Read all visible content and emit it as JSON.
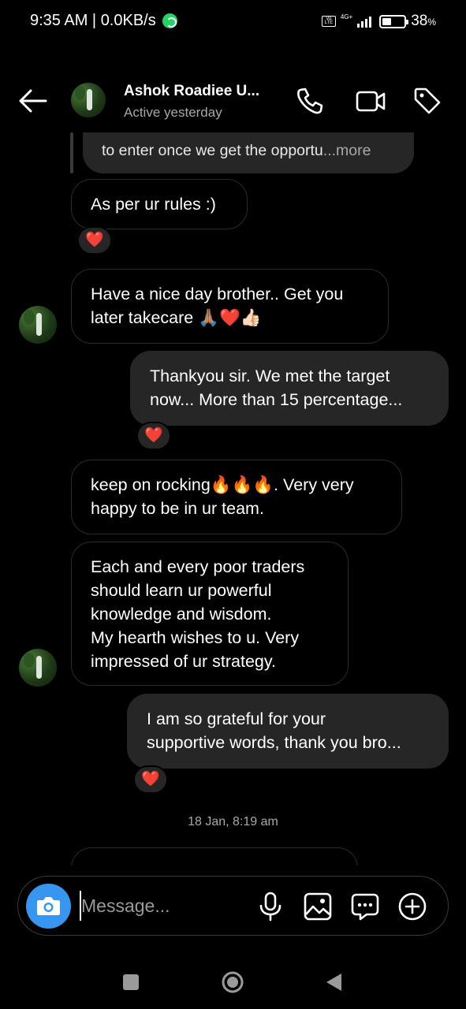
{
  "status_bar": {
    "time_speed": "9:35 AM | 0.0KB/s",
    "volte": "Vo LTE",
    "network": "4G+",
    "battery_pct": "38",
    "battery_unit": "%"
  },
  "header": {
    "contact_name": "Ashok Roadiee U...",
    "contact_status": "Active yesterday",
    "icons": [
      "back-arrow-icon",
      "phone-icon",
      "video-camera-icon",
      "tag-icon"
    ]
  },
  "thread": {
    "quoted_reply": {
      "text": "to enter once we get the opportu",
      "more_label": "...more"
    },
    "messages": [
      {
        "id": "m1",
        "direction": "in",
        "text": "As per ur rules :)",
        "reaction": "❤️"
      },
      {
        "id": "m2",
        "direction": "in",
        "lines": [
          "Have a nice day brother.. Get you",
          "later takecare 🙏🏽❤️👍🏻"
        ]
      },
      {
        "id": "m3",
        "direction": "out",
        "lines": [
          "Thankyou sir. We met the target",
          "now... More than 15 percentage..."
        ],
        "reaction": "❤️"
      },
      {
        "id": "m4",
        "direction": "in",
        "lines": [
          "keep on rocking🔥🔥🔥. Very very",
          "happy to be in ur team."
        ]
      },
      {
        "id": "m5",
        "direction": "in",
        "lines": [
          "Each and every poor traders",
          "should learn ur powerful",
          "knowledge and wisdom.",
          "My hearth wishes to u. Very",
          "impressed of ur strategy."
        ]
      },
      {
        "id": "m6",
        "direction": "out",
        "lines": [
          "I am so grateful for your",
          "supportive words, thank you bro..."
        ],
        "reaction": "❤️"
      }
    ],
    "timestamp": "18 Jan, 8:19 am"
  },
  "composer": {
    "placeholder": "Message...",
    "icons": [
      "camera-icon",
      "microphone-icon",
      "gallery-icon",
      "sticker-chat-icon",
      "add-plus-icon"
    ],
    "accent_color": "#3797f0"
  },
  "nav": {
    "icons": [
      "recents-square-icon",
      "home-circle-icon",
      "back-triangle-icon"
    ]
  }
}
